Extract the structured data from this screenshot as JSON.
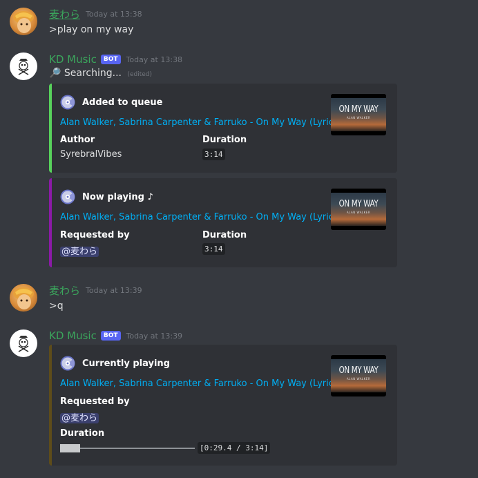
{
  "messages": [
    {
      "username": "麦わら",
      "timestamp": "Today at 13:38",
      "content": ">play on my way"
    },
    {
      "username": "KD Music",
      "bot_badge": "BOT",
      "timestamp": "Today at 13:38",
      "content_icon": "🔎",
      "content": "Searching...",
      "edited": "(edited)",
      "embeds": [
        {
          "accent": "#57d15b",
          "title": "Added to queue",
          "link": "Alan Walker, Sabrina Carpenter & Farruko  - On My Way (Lyrics)",
          "field1_name": "Author",
          "field1_value": "SyrebralVibes",
          "field2_name": "Duration",
          "field2_value": "3:14",
          "thumb_title": "ON MY WAY",
          "thumb_sub": "ALAN WALKER"
        },
        {
          "accent": "#8b1aa7",
          "title": "Now playing ♪",
          "link": "Alan Walker, Sabrina Carpenter & Farruko  - On My Way (Lyrics)",
          "field1_name": "Requested by",
          "field1_value": "@麦わら",
          "field2_name": "Duration",
          "field2_value": "3:14",
          "thumb_title": "ON MY WAY",
          "thumb_sub": "ALAN WALKER"
        }
      ]
    },
    {
      "username": "麦わら",
      "timestamp": "Today at 13:39",
      "content": ">q"
    },
    {
      "username": "KD Music",
      "bot_badge": "BOT",
      "timestamp": "Today at 13:39",
      "embeds": [
        {
          "accent": "#5e4c1a",
          "title": "Currently playing",
          "link": "Alan Walker, Sabrina Carpenter & Farruko  - On My Way (Lyrics)",
          "field1_name": "Requested by",
          "field1_value": "@麦わら",
          "field2_name": "Duration",
          "progress_bar": "███▬▬▬▬▬▬▬▬▬▬▬▬▬▬",
          "progress_text": "[0:29.4 / 3:14]",
          "progress_fraction": 0.15,
          "thumb_title": "ON MY WAY",
          "thumb_sub": "ALAN WALKER"
        }
      ]
    }
  ]
}
